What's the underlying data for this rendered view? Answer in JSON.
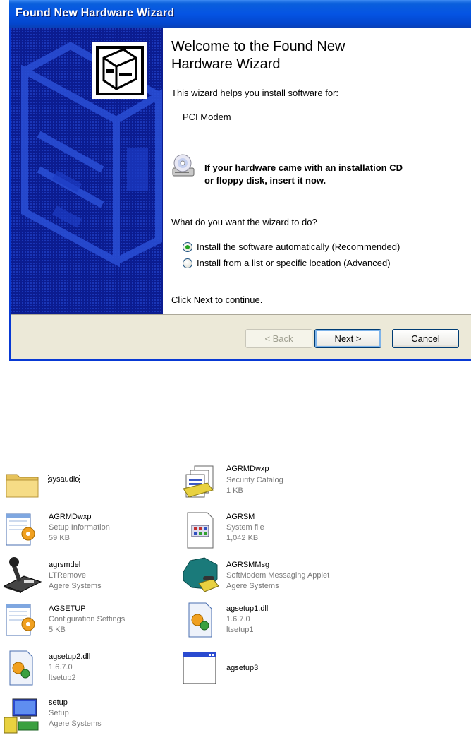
{
  "wizard": {
    "title": "Found New Hardware Wizard",
    "heading_line1": "Welcome to the Found New",
    "heading_line2": "Hardware Wizard",
    "helps_text": "This wizard helps you install software for:",
    "device_name": "PCI Modem",
    "cd_line1": "If your hardware came with an installation CD",
    "cd_line2": "or floppy disk, insert it now.",
    "question": "What do you want the wizard to do?",
    "options": [
      {
        "label": "Install the software automatically (Recommended)",
        "selected": true
      },
      {
        "label": "Install from a list or specific location (Advanced)",
        "selected": false
      }
    ],
    "continue_text": "Click Next to continue.",
    "buttons": {
      "back": "< Back",
      "next": "Next >",
      "cancel": "Cancel"
    },
    "colors": {
      "titlebar": "#0554e3",
      "left_panel": "#0a1a8c"
    }
  },
  "files": [
    {
      "name": "sysaudio",
      "line2": "",
      "line3": "",
      "icon": "folder-icon"
    },
    {
      "name": "AGRMDwxp",
      "line2": "Security Catalog",
      "line3": "1 KB",
      "icon": "security-catalog-icon"
    },
    {
      "name": "AGRMDwxp",
      "line2": "Setup Information",
      "line3": "59 KB",
      "icon": "setup-information-icon"
    },
    {
      "name": "AGRSM",
      "line2": "System file",
      "line3": "1,042 KB",
      "icon": "system-file-icon"
    },
    {
      "name": "agrsmdel",
      "line2": "LTRemove",
      "line3": "Agere Systems",
      "icon": "ltremove-icon"
    },
    {
      "name": "AGRSMMsg",
      "line2": "SoftModem Messaging Applet",
      "line3": "Agere Systems",
      "icon": "softmodem-applet-icon"
    },
    {
      "name": "AGSETUP",
      "line2": "Configuration Settings",
      "line3": "5 KB",
      "icon": "config-settings-icon"
    },
    {
      "name": "agsetup1.dll",
      "line2": "1.6.7.0",
      "line3": "ltsetup1",
      "icon": "dll-icon"
    },
    {
      "name": "agsetup2.dll",
      "line2": "1.6.7.0",
      "line3": "ltsetup2",
      "icon": "dll-icon"
    },
    {
      "name": "agsetup3",
      "line2": "",
      "line3": "",
      "icon": "application-window-icon"
    },
    {
      "name": "setup",
      "line2": "Setup",
      "line3": "Agere Systems",
      "icon": "setup-installer-icon"
    }
  ]
}
